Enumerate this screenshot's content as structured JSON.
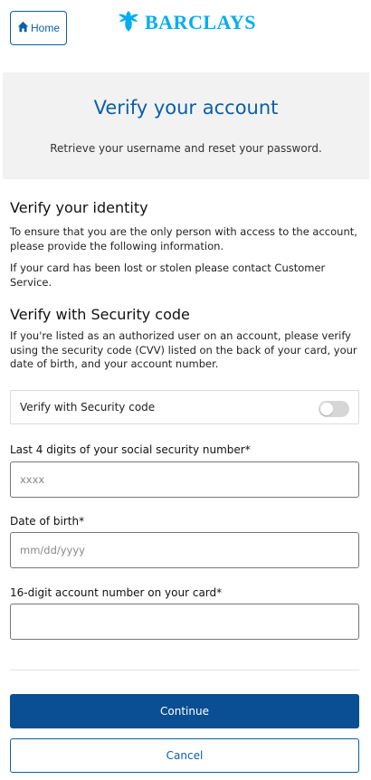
{
  "header": {
    "home_label": "Home",
    "brand_name": "BARCLAYS",
    "brand_color": "#00aeef"
  },
  "hero": {
    "title": "Verify your account",
    "subtitle": "Retrieve your username and reset your password."
  },
  "identity": {
    "heading": "Verify your identity",
    "paragraph1": "To ensure that you are the only person with access to the account, please provide the following information.",
    "paragraph2": "If your card has been lost or stolen please contact Customer Service."
  },
  "security": {
    "heading": "Verify with Security code",
    "paragraph": "If you're listed as an authorized user on an account, please verify using the security code (CVV) listed on the back of your card, your date of birth, and your account number.",
    "toggle_label": "Verify with Security code",
    "toggle_on": false
  },
  "form": {
    "ssn_label": "Last 4 digits of your social security number*",
    "ssn_placeholder": "xxxx",
    "dob_label": "Date of birth*",
    "dob_placeholder": "mm/dd/yyyy",
    "account_label": "16-digit account number on your card*",
    "account_placeholder": ""
  },
  "actions": {
    "continue_label": "Continue",
    "cancel_label": "Cancel"
  },
  "colors": {
    "primary": "#0a4f93",
    "link": "#0a5fa8",
    "panel_bg": "#f2f2f2"
  },
  "icons": {
    "home": "home-icon",
    "brand": "eagle-logo-icon"
  }
}
